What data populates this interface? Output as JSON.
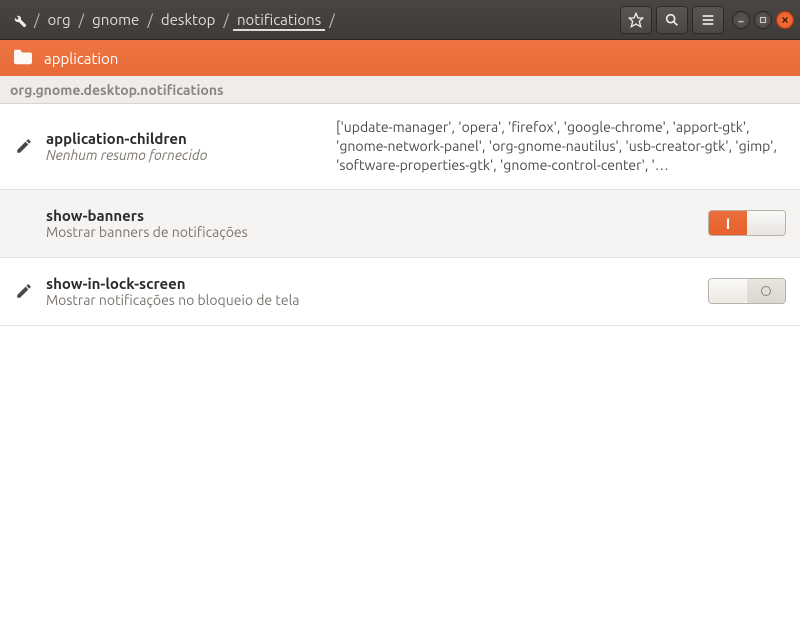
{
  "breadcrumb": {
    "sep": "/",
    "items": [
      "org",
      "gnome",
      "desktop",
      "notifications"
    ],
    "current_index": 3
  },
  "orange_bar": {
    "label": "application"
  },
  "schema_path": "org.gnome.desktop.notifications",
  "rows": [
    {
      "key": "application-children",
      "summary": "Nenhum resumo fornecido",
      "summary_italic": true,
      "modified": true,
      "value": "['update-manager', 'opera', 'firefox', 'google-chrome', 'apport-gtk', 'gnome-network-panel', 'org-gnome-nautilus', 'usb-creator-gtk', 'gimp', 'software-properties-gtk', 'gnome-control-center', '…",
      "toggle": null
    },
    {
      "key": "show-banners",
      "summary": "Mostrar banners de notificações",
      "summary_italic": false,
      "modified": false,
      "value": null,
      "toggle": true
    },
    {
      "key": "show-in-lock-screen",
      "summary": "Mostrar notificações no bloqueio de tela",
      "summary_italic": false,
      "modified": true,
      "value": null,
      "toggle": false
    }
  ],
  "switch_on_label": "I"
}
